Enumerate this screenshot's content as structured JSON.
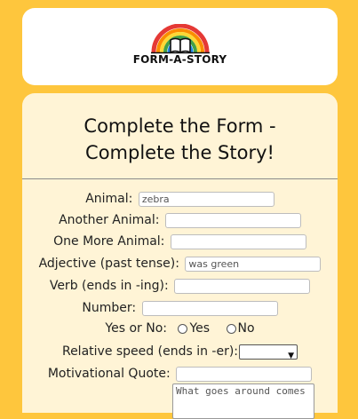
{
  "brand": {
    "name": "FORM-A-STORY"
  },
  "heading": {
    "line1": "Complete the Form -",
    "line2": "Complete the Story!"
  },
  "form": {
    "animal": {
      "label": "Animal:",
      "value": "zebra"
    },
    "another_animal": {
      "label": "Another Animal:",
      "value": ""
    },
    "one_more_animal": {
      "label": "One More Animal:",
      "value": ""
    },
    "adjective": {
      "label": "Adjective (past tense):",
      "value": "was green"
    },
    "verb": {
      "label": "Verb (ends in -ing):",
      "value": ""
    },
    "number": {
      "label": "Number:",
      "value": ""
    },
    "yes_no": {
      "label": "Yes or No:",
      "options": [
        "Yes",
        "No"
      ]
    },
    "speed": {
      "label": "Relative speed (ends in -er):",
      "selected": ""
    },
    "quote": {
      "label": "Motivational Quote:",
      "value": "",
      "textarea_value": "What goes around comes"
    }
  },
  "colors": {
    "page_bg": "#fec63d",
    "card_bg": "#fff4d6",
    "header_bg": "#ffffff"
  }
}
